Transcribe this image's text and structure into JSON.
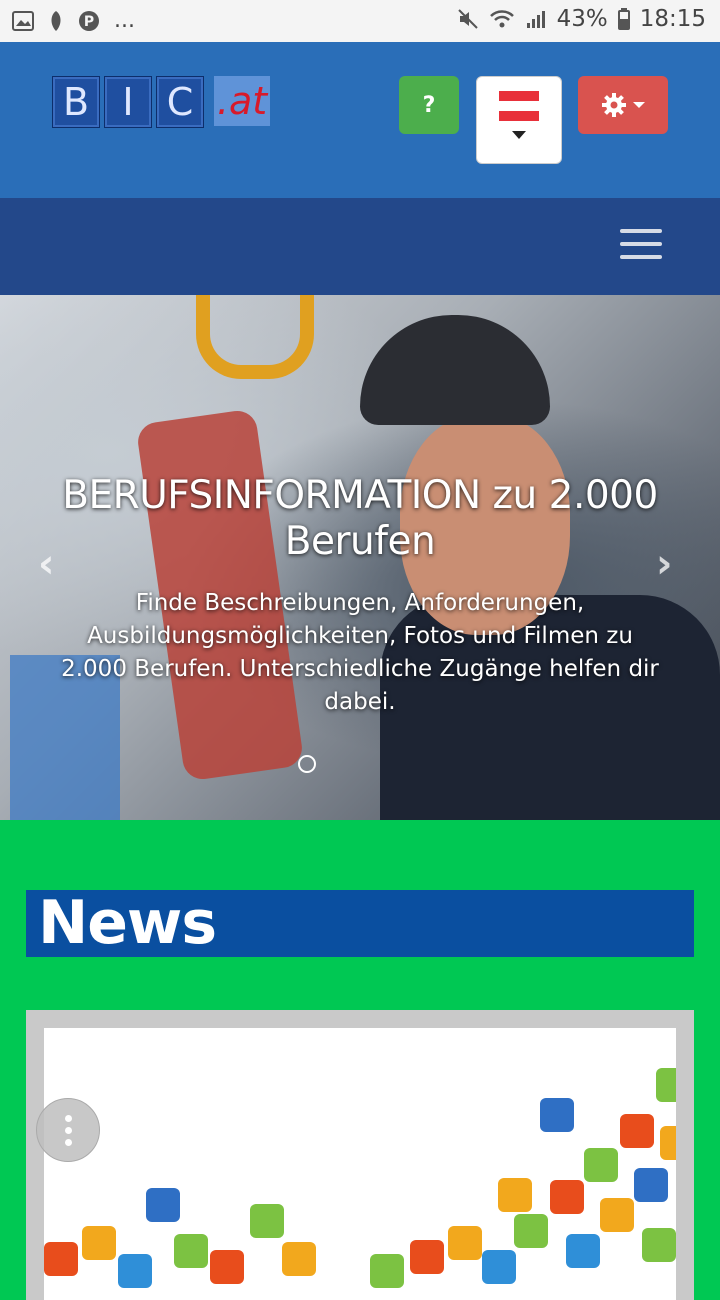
{
  "status_bar": {
    "left_icons": [
      "image-icon",
      "leaf-icon",
      "pinterest-icon"
    ],
    "more": "...",
    "battery": "43%",
    "time": "18:15"
  },
  "header": {
    "logo_letters": [
      "B",
      "I",
      "C"
    ],
    "logo_suffix": ".at",
    "help_label": "?",
    "settings_icon": "gear-icon",
    "language_flag": "austria-flag"
  },
  "carousel": {
    "title": "BERUFSINFORMATION zu 2.000 Berufen",
    "text": "Finde Beschreibungen, Anforderungen, Ausbildungsmöglichkeiten, Fotos und Filmen zu 2.000 Berufen. Unterschiedliche Zugänge helfen dir dabei.",
    "prev_symbol": "‹",
    "next_symbol": "›"
  },
  "news": {
    "title": "News"
  },
  "colors": {
    "header_bg": "#2a6eb8",
    "navbar_bg": "#23488a",
    "page_bg": "#00c853",
    "news_header_bg": "#0a4fa0",
    "help_btn": "#4cae4c",
    "settings_btn": "#d9534f"
  }
}
